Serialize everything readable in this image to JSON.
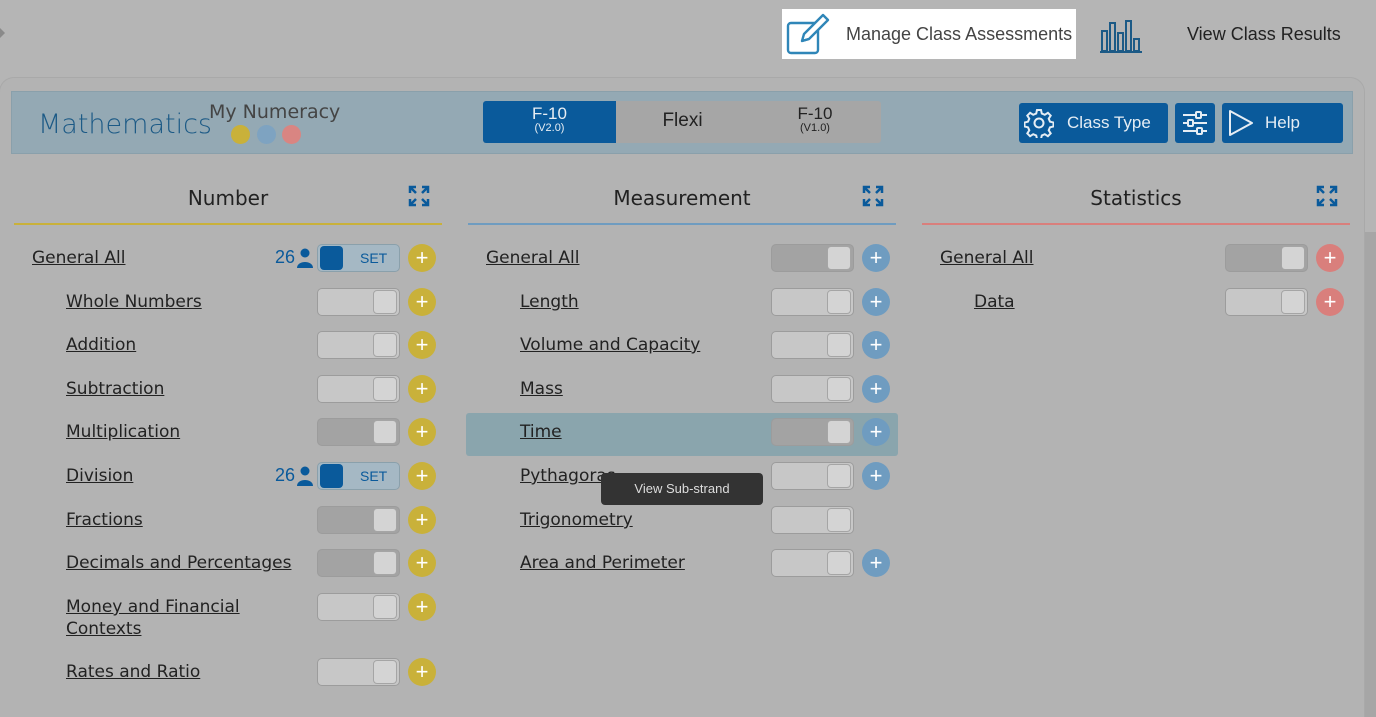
{
  "top_tabs": {
    "manage_label": "Manage Class Assessments",
    "results_label": "View Class Results"
  },
  "header": {
    "subject": "Mathematics",
    "program": "My Numeracy",
    "dots": [
      "#c9b13a",
      "#7ea3c1",
      "#d98582"
    ],
    "versions": [
      {
        "main": "F-10",
        "sub": "(V2.0)"
      },
      {
        "main": "Flexi",
        "sub": ""
      },
      {
        "main": "F-10",
        "sub": "(V1.0)"
      }
    ],
    "class_type_label": "Class Type",
    "help_label": "Help"
  },
  "colors": {
    "number": "#c9b13a",
    "measurement": "#6f9cc0",
    "statistics": "#d97f7c",
    "accent": "#0a5a9b"
  },
  "columns": {
    "number": {
      "title": "Number",
      "general": {
        "label": "General All",
        "count": "26",
        "set_label": "SET"
      },
      "items": [
        {
          "label": "Whole Numbers"
        },
        {
          "label": "Addition"
        },
        {
          "label": "Subtraction"
        },
        {
          "label": "Multiplication"
        },
        {
          "label": "Division",
          "count": "26",
          "set_label": "SET"
        },
        {
          "label": "Fractions"
        },
        {
          "label": "Decimals and Percentages"
        },
        {
          "label": "Money and Financial Contexts"
        },
        {
          "label": "Rates and Ratio"
        }
      ]
    },
    "measurement": {
      "title": "Measurement",
      "general": {
        "label": "General All"
      },
      "items": [
        {
          "label": "Length"
        },
        {
          "label": "Volume and Capacity"
        },
        {
          "label": "Mass"
        },
        {
          "label": "Time"
        },
        {
          "label": "Pythagoras"
        },
        {
          "label": "Trigonometry"
        },
        {
          "label": "Area and Perimeter"
        }
      ]
    },
    "statistics": {
      "title": "Statistics",
      "general": {
        "label": "General All"
      },
      "items": [
        {
          "label": "Data"
        }
      ]
    }
  },
  "plus_glyph": "+",
  "tooltip": "View Sub-strand"
}
